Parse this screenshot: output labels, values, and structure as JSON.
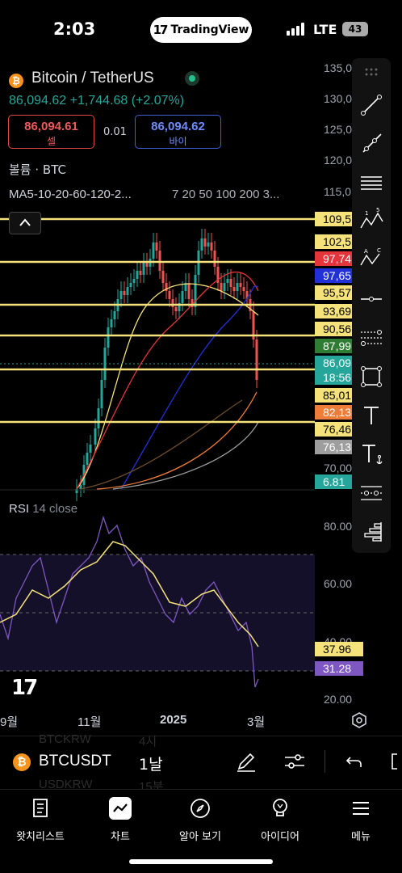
{
  "status_bar": {
    "time": "2:03",
    "app_pill": "TradingView",
    "network": "LTE",
    "battery": "43"
  },
  "header": {
    "symbol_title": "Bitcoin / TetherUS",
    "price_line": "86,094.62  +1,744.68 (+2.07%)",
    "sell_price": "86,094.61",
    "sell_label": "셀",
    "spread": "0.01",
    "buy_price": "86,094.62",
    "buy_label": "바이",
    "volume_label": "볼륨 · BTC",
    "ma_label": "MA5-10-20-60-120-2...",
    "ma_values": "7  20  50  100  200  3..."
  },
  "price_axis": [
    "135,0",
    "130,0",
    "125,0",
    "120,0",
    "115,0",
    "70,00"
  ],
  "price_labels": [
    {
      "text": "109,5",
      "bg": "#f5e27a",
      "fg": "#000000"
    },
    {
      "text": "102,5",
      "bg": "#f5e27a",
      "fg": "#000000"
    },
    {
      "text": "97,74",
      "bg": "#e5343a",
      "fg": "#ffffff"
    },
    {
      "text": "97,65",
      "bg": "#2230d8",
      "fg": "#ffffff"
    },
    {
      "text": "95,57",
      "bg": "#f5e27a",
      "fg": "#000000"
    },
    {
      "text": "93,69",
      "bg": "#f5e27a",
      "fg": "#000000"
    },
    {
      "text": "90,56",
      "bg": "#f5e27a",
      "fg": "#000000"
    },
    {
      "text": "87,99",
      "bg": "#2e7d32",
      "fg": "#ffffff"
    },
    {
      "text": "86,09",
      "bg": "#26a69a",
      "fg": "#ffffff"
    },
    {
      "text": "18:56",
      "bg": "#26a69a",
      "fg": "#ffffff"
    },
    {
      "text": "85,01",
      "bg": "#f5e27a",
      "fg": "#000000"
    },
    {
      "text": "82,13",
      "bg": "#ef7d3a",
      "fg": "#ffffff"
    },
    {
      "text": "76,46",
      "bg": "#f5e27a",
      "fg": "#000000"
    },
    {
      "text": "76,13",
      "bg": "#9e9e9e",
      "fg": "#ffffff"
    },
    {
      "text": "6.81",
      "bg": "#26a69a",
      "fg": "#ffffff"
    }
  ],
  "rsi": {
    "label": "RSI",
    "params": "14 close",
    "axis": [
      "80.00",
      "60.00",
      "40.00",
      "20.00"
    ],
    "value_yellow": "37.96",
    "value_purple": "31.28"
  },
  "time_axis": [
    "9월",
    "11월",
    "2025",
    "3월"
  ],
  "symbol_bar": {
    "symbol": "BTCUSDT",
    "interval": "1날",
    "ghost_top": "BTCKRW",
    "ghost_top_val": "4시",
    "ghost_bottom": "USDKRW",
    "ghost_bottom_val": "15분"
  },
  "tabs": [
    {
      "label": "왓치리스트",
      "icon": "watchlist-icon"
    },
    {
      "label": "차트",
      "icon": "chart-icon"
    },
    {
      "label": "알아 보기",
      "icon": "explore-compass-icon"
    },
    {
      "label": "아이디어",
      "icon": "ideas-bulb-icon"
    },
    {
      "label": "메뉴",
      "icon": "menu-icon"
    }
  ],
  "colors": {
    "bg": "#000000",
    "up": "#26a69a",
    "down": "#ef5350",
    "hline": "#f5e27a",
    "rsi": "#7e57c2"
  }
}
